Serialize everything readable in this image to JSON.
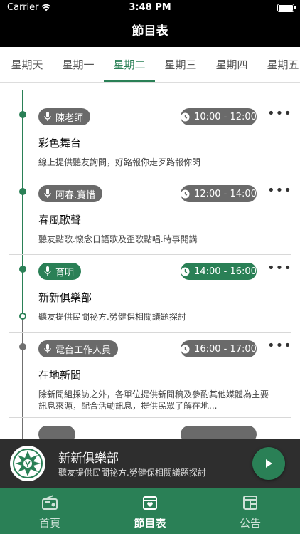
{
  "status_bar": {
    "carrier": "Carrier",
    "time": "3:48 PM"
  },
  "nav": {
    "title": "節目表"
  },
  "tabs": [
    "星期天",
    "星期一",
    "星期二",
    "星期三",
    "星期四",
    "星期五"
  ],
  "active_tab": "星期二",
  "programs": [
    {
      "host": "陳老師",
      "time": "10:00 - 12:00",
      "title": "彩色舞台",
      "description": "線上提供聽友詢問，好路報你走歹路報你閃",
      "live": false
    },
    {
      "host": "阿春.寶惜",
      "time": "12:00 - 14:00",
      "title": "春風歌聲",
      "description": "聽友點歌.懷念日語歌及歪歌點唱.時事開講",
      "live": false
    },
    {
      "host": "育明",
      "time": "14:00 - 16:00",
      "title": "新新俱樂部",
      "description": "聽友提供民間祕方.勞健保相關議題探討",
      "live": true
    },
    {
      "host": "電台工作人員",
      "time": "16:00 - 17:00",
      "title": "在地新聞",
      "description": "除新聞組採訪之外，各單位提供新聞稿及參酌其他媒體為主要訊息來源，配合活動訊息，提供民眾了解在地...",
      "live": false
    }
  ],
  "player": {
    "title": "新新俱樂部",
    "subtitle": "聽友提供民間祕方.勞健保相關議題探討"
  },
  "tabbar": {
    "home": "首頁",
    "schedule": "節目表",
    "notice": "公告"
  },
  "colors": {
    "accent": "#2a8056",
    "pill_gray": "#6a6a6a",
    "player_bg": "#2e2e2e"
  },
  "icons": {
    "wifi": "wifi-icon",
    "mic": "microphone-icon",
    "clock": "clock-icon",
    "more": "more-horizontal-icon",
    "play": "play-icon",
    "radio": "radio-icon",
    "calendar": "calendar-heart-icon",
    "board": "notice-board-icon"
  }
}
